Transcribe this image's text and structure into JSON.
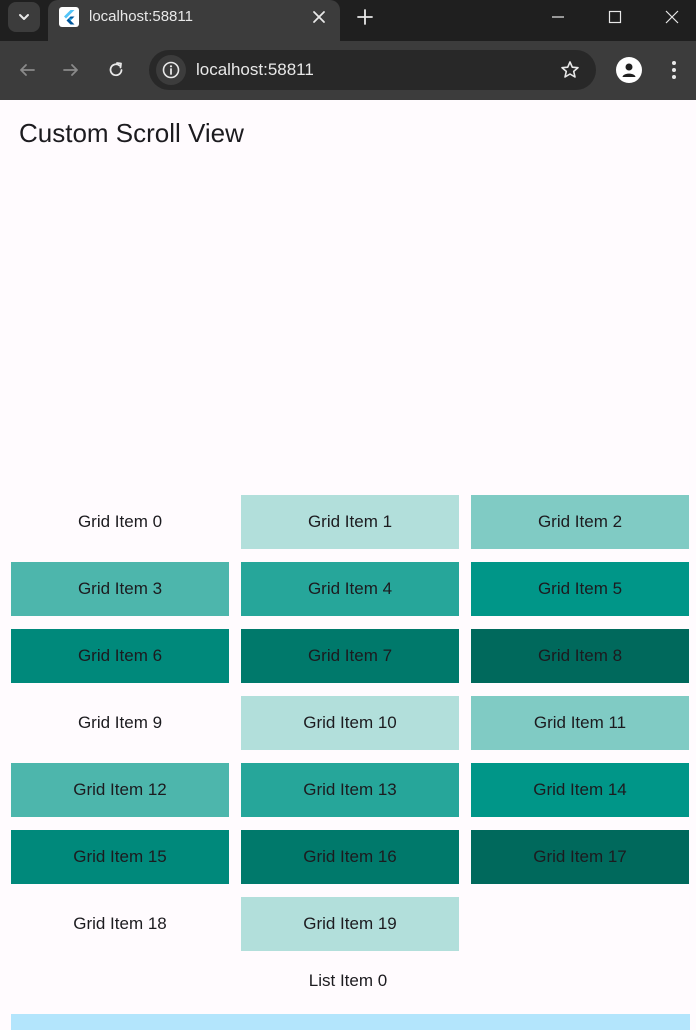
{
  "browser": {
    "tab_title": "localhost:58811",
    "url": "localhost:58811",
    "icons": {
      "tab_list": "chevron-down-icon",
      "favicon": "flutter-logo-icon",
      "close": "close-icon",
      "new_tab": "plus-icon",
      "back": "arrow-left-icon",
      "forward": "arrow-right-icon",
      "reload": "reload-icon",
      "site_info": "info-icon",
      "bookmark": "star-icon",
      "profile": "person-icon",
      "menu": "more-vert-icon",
      "minimize": "minimize-icon",
      "maximize": "maximize-icon",
      "window_close": "window-close-icon"
    }
  },
  "app": {
    "title": "Custom Scroll View"
  },
  "grid": {
    "items": [
      {
        "label": "Grid Item 0",
        "color": "#fffbfe"
      },
      {
        "label": "Grid Item 1",
        "color": "#b2dfdb"
      },
      {
        "label": "Grid Item 2",
        "color": "#80cbc4"
      },
      {
        "label": "Grid Item 3",
        "color": "#4db6ac"
      },
      {
        "label": "Grid Item 4",
        "color": "#26a69a"
      },
      {
        "label": "Grid Item 5",
        "color": "#009688"
      },
      {
        "label": "Grid Item 6",
        "color": "#00897b"
      },
      {
        "label": "Grid Item 7",
        "color": "#00796b"
      },
      {
        "label": "Grid Item 8",
        "color": "#00695c"
      },
      {
        "label": "Grid Item 9",
        "color": "#fffbfe"
      },
      {
        "label": "Grid Item 10",
        "color": "#b2dfdb"
      },
      {
        "label": "Grid Item 11",
        "color": "#80cbc4"
      },
      {
        "label": "Grid Item 12",
        "color": "#4db6ac"
      },
      {
        "label": "Grid Item 13",
        "color": "#26a69a"
      },
      {
        "label": "Grid Item 14",
        "color": "#009688"
      },
      {
        "label": "Grid Item 15",
        "color": "#00897b"
      },
      {
        "label": "Grid Item 16",
        "color": "#00796b"
      },
      {
        "label": "Grid Item 17",
        "color": "#00695c"
      },
      {
        "label": "Grid Item 18",
        "color": "#fffbfe"
      },
      {
        "label": "Grid Item 19",
        "color": "#b2dfdb"
      }
    ]
  },
  "list": {
    "items": [
      {
        "label": "List Item 0",
        "color": "#fffbfe"
      },
      {
        "label": "",
        "color": "#b3e5fc"
      }
    ]
  }
}
